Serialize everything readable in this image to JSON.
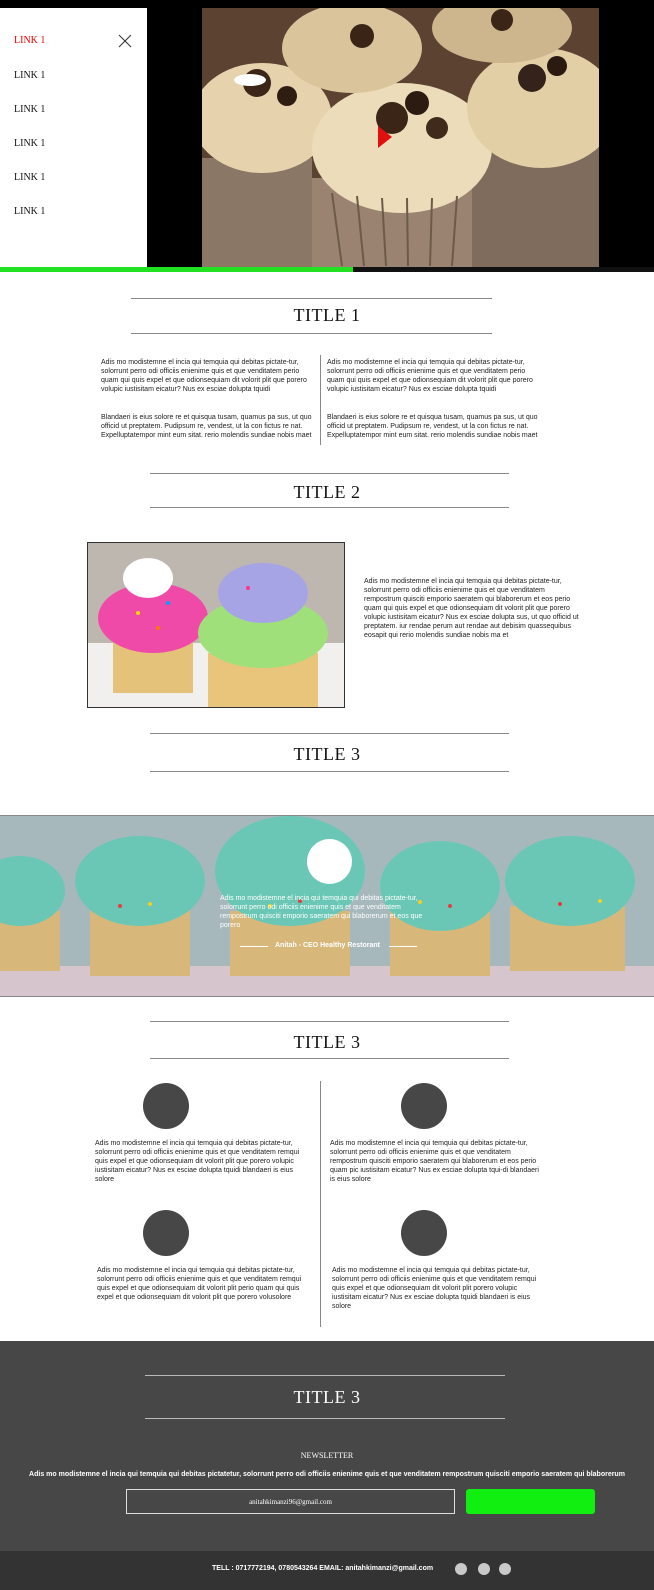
{
  "nav": {
    "links": [
      "LINK 1",
      "LINK 1",
      "LINK 1",
      "LINK 1",
      "LINK 1",
      "LINK 1"
    ],
    "active_color": "#ee0000"
  },
  "progress": {
    "percent": 54,
    "color": "#22e022"
  },
  "section1": {
    "title": "TITLE 1",
    "col1_p1": "Adis mo modistemne el incia qui temquia qui debitas pictate-tur, solorrunt perro odi officiis enienime quis et que venditatem perio quam qui quis expel et que odionsequiam dit volorit plit que porero volupic iustisitam eicatur? Nus ex esciae dolupta tquidi",
    "col1_p2": "Blandaeri is eius solore re et quisqua tusam, quamus pa sus, ut quo officid ut preptatem. Pudipsum re, vendest, ut la con fictus re nat. Expelluptatempor mint eum sitat. rerio molendis sundiae nobis maet",
    "col2_p1": "Adis mo modistemne el incia qui temquia qui debitas pictate-tur, solorrunt perro odi officiis enienime quis et que venditatem perio quam qui quis expel et que odionsequiam dit volorit plit que porero volupic iustisitam eicatur? Nus ex esciae dolupta tquidi",
    "col2_p2": "Blandaeri is eius solore re et quisqua tusam, quamus pa sus, ut quo officid ut preptatem. Pudipsum re, vendest, ut la con fictus re nat. Expelluptatempor mint eum sitat. rerio molendis sundiae nobis maet"
  },
  "section2": {
    "title": "TITLE 2",
    "text": "Adis mo modistemne el incia qui temquia qui debitas pictate-tur, solorrunt perro odi officiis enienime quis et que venditatem rempostrum quisciti emporio saeratem qui blaborerum et eos perio quam qui quis expel et que odionsequiam dit volorit plit que porero volupic iustisitam eicatur? Nus ex esciae dolupta sus, ut quo officid ut preptatem. iur rendae perum aut rendae aut debisim quassequibus eosapit qui rerio molendis sundiae nobis ma et"
  },
  "section3": {
    "title": "TITLE 3",
    "quote": "Adis mo modistemne el incia qui temquia qui debitas pictate-tur, solorrunt perro odi officiis enienime quis et que venditatem rempostrum quisciti emporio saeratem qui blaborerum et eos que porero",
    "author": "Anitah - CEO Healthy Restorant"
  },
  "section4": {
    "title": "TITLE 3",
    "items": [
      "Adis mo modistemne el incia qui temquia qui debitas pictate-tur, solorrunt perro odi officiis enienime quis et que venditatem remqui quis expel et que odionsequiam dit volorit plit que porero volupic iustisitam eicatur? Nus ex esciae dolupta tquidi blandaeri is eius solore",
      "Adis mo modistemne el incia qui temquia qui debitas pictate-tur, solorrunt perro odi officiis enienime quis et que venditatem rempostrum quisciti emporio saeratem qui blaborerum et eos perio quam pic iustisitam eicatur? Nus ex esciae dolupta tqui-di blandaeri is eius solore",
      "Adis mo modistemne el incia qui temquia qui debitas pictate-tur, solorrunt perro odi officiis enienime quis et que venditatem remqui quis expel et que odionsequiam dit volorit plit perio quam qui quis expel et que odionsequiam dit volorit plit que porero volusolore",
      "Adis mo modistemne el incia qui temquia qui debitas pictate-tur, solorrunt perro odi officiis enienime quis et que venditatem remqui quis expel et que odionsequiam dit volorit plit porero volupic iustisitam eicatur? Nus ex esciae dolupta tquidi blandaeri is eius solore"
    ]
  },
  "footer": {
    "title": "TITLE 3",
    "newsletter_heading": "NEWSLETTER",
    "newsletter_text": "Adis mo modistemne el incia qui temquia qui debitas pictatetur, solorrunt perro odi officiis enienime quis et que venditatem rempostrum quisciti emporio saeratem qui blaborerum",
    "email_value": "anitahkimanzi96@gmail.com",
    "contact": "TELL :  0717772194, 0780543264 EMAIL: anitahkimanzi@gmail.com",
    "button_color": "#10ef10"
  }
}
